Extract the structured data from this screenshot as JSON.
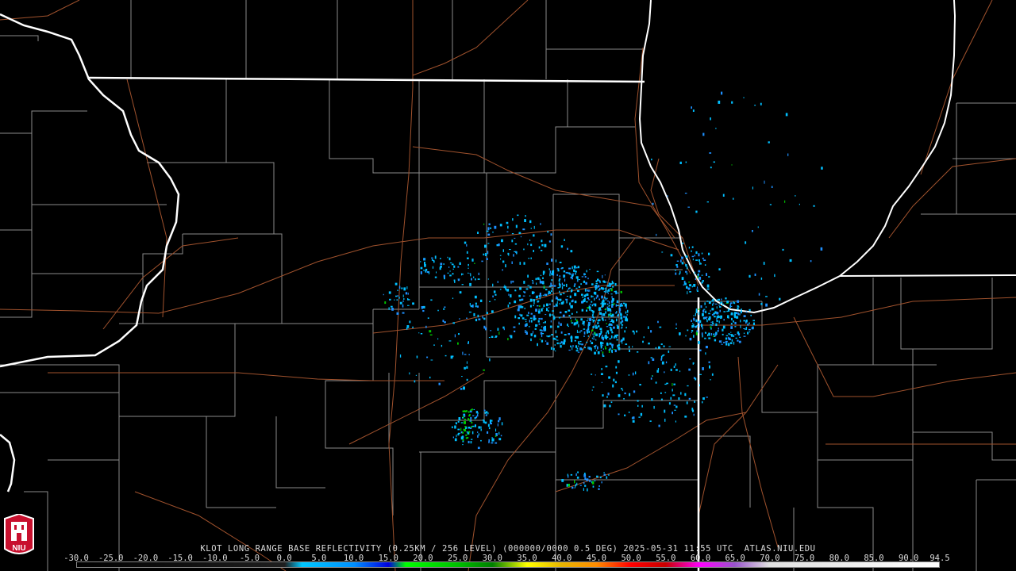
{
  "product_title": "KLOT LONG RANGE BASE REFLECTIVITY (0.25KM / 256 LEVEL) (000000/0000 0.5 DEG) 2025-05-31 11:55 UTC  ATLAS.NIU.EDU",
  "logo_text": "NIU",
  "colorbar": {
    "ticks": [
      "-30.0",
      "-25.0",
      "-20.0",
      "-15.0",
      "-10.0",
      "-5.0",
      "0.0",
      "5.0",
      "10.0",
      "15.0",
      "20.0",
      "25.0",
      "30.0",
      "35.0",
      "40.0",
      "45.0",
      "50.0",
      "55.0",
      "60.0",
      "65.0",
      "70.0",
      "75.0",
      "80.0",
      "85.0",
      "90.0",
      "94.5"
    ],
    "min": -30.0,
    "max": 94.5,
    "stops": [
      {
        "value": -30.0,
        "color": "#000000"
      },
      {
        "value": 0.0,
        "color": "#1e1e1e"
      },
      {
        "value": 2.5,
        "color": "#00c8ff"
      },
      {
        "value": 10.0,
        "color": "#0090ff"
      },
      {
        "value": 15.0,
        "color": "#0000e0"
      },
      {
        "value": 17.5,
        "color": "#00ff00"
      },
      {
        "value": 25.0,
        "color": "#00c000"
      },
      {
        "value": 30.0,
        "color": "#008000"
      },
      {
        "value": 35.0,
        "color": "#ffff00"
      },
      {
        "value": 40.0,
        "color": "#e6b400"
      },
      {
        "value": 45.0,
        "color": "#ff8c00"
      },
      {
        "value": 50.0,
        "color": "#ff0000"
      },
      {
        "value": 55.0,
        "color": "#c80000"
      },
      {
        "value": 60.0,
        "color": "#ff00ff"
      },
      {
        "value": 65.0,
        "color": "#9955cc"
      },
      {
        "value": 70.0,
        "color": "#e0e0e0"
      },
      {
        "value": 94.5,
        "color": "#ffffff"
      }
    ]
  },
  "colors": {
    "background": "#000000",
    "state_border": "#ffffff",
    "county_border": "#8a8a8a",
    "roads": "#a0522d",
    "echo_light": "#00bfff",
    "echo_mid": "#1e90ff",
    "echo_strong": "#00c800"
  }
}
